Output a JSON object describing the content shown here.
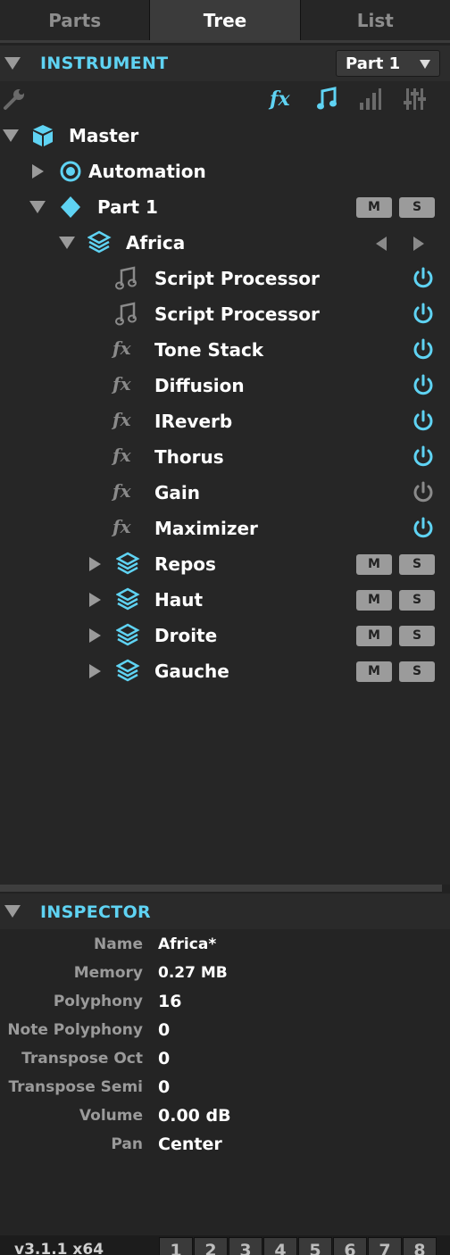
{
  "tabs": [
    {
      "label": "Parts",
      "active": false
    },
    {
      "label": "Tree",
      "active": true
    },
    {
      "label": "List",
      "active": false
    }
  ],
  "instrument": {
    "title": "INSTRUMENT",
    "part_select": "Part 1"
  },
  "toolbar": {
    "fx_label": "fx",
    "icons": [
      "wrench-icon",
      "fx-filter-icon",
      "note-filter-icon",
      "bars-icon",
      "sliders-icon"
    ]
  },
  "tree": {
    "master": "Master",
    "automation": "Automation",
    "part": "Part 1",
    "layer": "Africa",
    "modules": [
      {
        "kind": "note",
        "label": "Script Processor",
        "enabled": true
      },
      {
        "kind": "note",
        "label": "Script Processor",
        "enabled": true
      },
      {
        "kind": "fx",
        "label": "Tone Stack",
        "enabled": true
      },
      {
        "kind": "fx",
        "label": "Diffusion",
        "enabled": true
      },
      {
        "kind": "fx",
        "label": "IReverb",
        "enabled": true
      },
      {
        "kind": "fx",
        "label": "Thorus",
        "enabled": true
      },
      {
        "kind": "fx",
        "label": "Gain",
        "enabled": false
      },
      {
        "kind": "fx",
        "label": "Maximizer",
        "enabled": true
      }
    ],
    "sublayers": [
      "Repos",
      "Haut",
      "Droite",
      "Gauche"
    ],
    "fx_glyph": "fx",
    "mute_label": "M",
    "solo_label": "S"
  },
  "inspector": {
    "title": "INSPECTOR",
    "props": [
      {
        "key": "Name",
        "value": "Africa*"
      },
      {
        "key": "Memory",
        "value": "0.27 MB"
      },
      {
        "key": "Polyphony",
        "value": "16"
      },
      {
        "key": "Note Polyphony",
        "value": "0"
      },
      {
        "key": "Transpose Oct",
        "value": "0"
      },
      {
        "key": "Transpose Semi",
        "value": "0"
      },
      {
        "key": "Volume",
        "value": "0.00 dB"
      },
      {
        "key": "Pan",
        "value": "Center"
      }
    ]
  },
  "footer": {
    "version": "v3.1.1 x64",
    "pages": [
      "1",
      "2",
      "3",
      "4",
      "5",
      "6",
      "7",
      "8"
    ]
  },
  "colors": {
    "accent": "#5fd3f3",
    "disabled": "#8a8a8a",
    "background": "#262626"
  }
}
